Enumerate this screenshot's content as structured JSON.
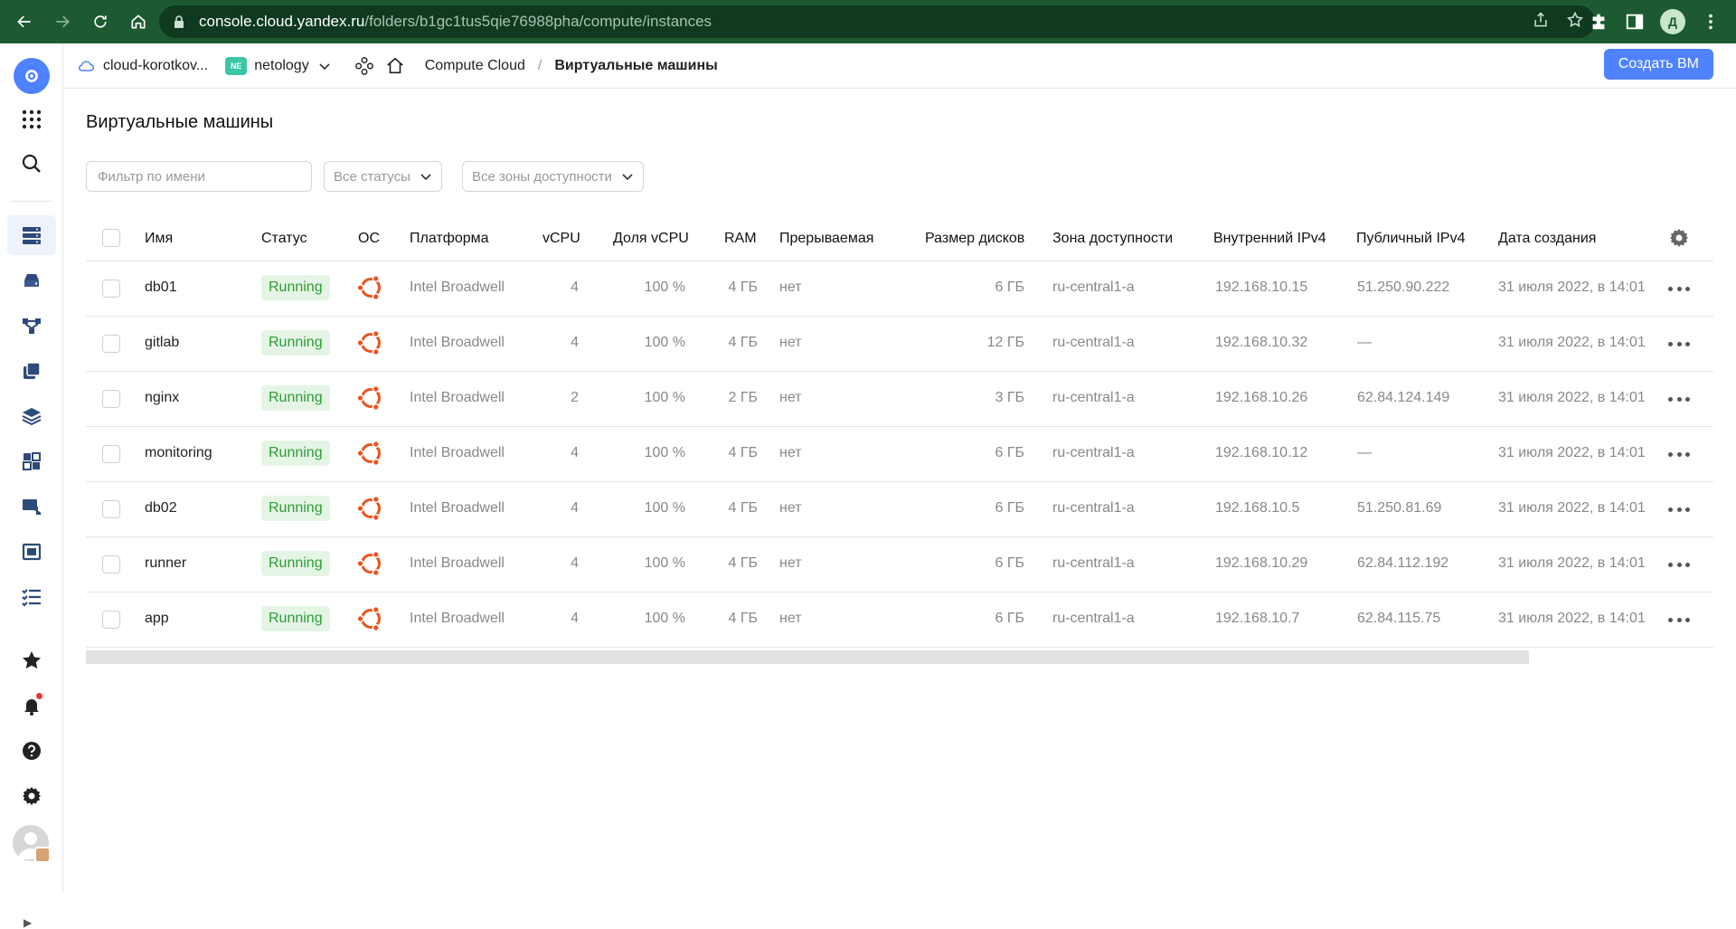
{
  "browser": {
    "url_host": "console.cloud.yandex.ru",
    "url_path": "/folders/b1gc1tus5qie76988pha/compute/instances",
    "profile_initial": "Д"
  },
  "header": {
    "cloud_name": "cloud-korotkov...",
    "folder_badge": "NE",
    "folder_name": "netology",
    "breadcrumb_service": "Compute Cloud",
    "breadcrumb_sep": "/",
    "breadcrumb_current": "Виртуальные машины",
    "create_button": "Создать ВМ"
  },
  "page": {
    "title": "Виртуальные машины",
    "filter_placeholder": "Фильтр по имени",
    "status_select": "Все статусы",
    "zone_select": "Все зоны доступности"
  },
  "table": {
    "columns": {
      "name": "Имя",
      "status": "Статус",
      "os": "ОС",
      "platform": "Платформа",
      "vcpu": "vCPU",
      "vcpu_share": "Доля vCPU",
      "ram": "RAM",
      "preemptible": "Прерываемая",
      "disk_size": "Размер дисков",
      "zone": "Зона доступности",
      "internal_ip": "Внутренний IPv4",
      "public_ip": "Публичный IPv4",
      "created": "Дата создания"
    },
    "rows": [
      {
        "name": "db01",
        "status": "Running",
        "platform": "Intel Broadwell",
        "vcpu": "4",
        "share": "100 %",
        "ram": "4 ГБ",
        "preemptible": "нет",
        "disk": "6 ГБ",
        "zone": "ru-central1-a",
        "internal_ip": "192.168.10.15",
        "public_ip": "51.250.90.222",
        "created": "31 июля 2022, в 14:01"
      },
      {
        "name": "gitlab",
        "status": "Running",
        "platform": "Intel Broadwell",
        "vcpu": "4",
        "share": "100 %",
        "ram": "4 ГБ",
        "preemptible": "нет",
        "disk": "12 ГБ",
        "zone": "ru-central1-a",
        "internal_ip": "192.168.10.32",
        "public_ip": "—",
        "created": "31 июля 2022, в 14:01"
      },
      {
        "name": "nginx",
        "status": "Running",
        "platform": "Intel Broadwell",
        "vcpu": "2",
        "share": "100 %",
        "ram": "2 ГБ",
        "preemptible": "нет",
        "disk": "3 ГБ",
        "zone": "ru-central1-a",
        "internal_ip": "192.168.10.26",
        "public_ip": "62.84.124.149",
        "created": "31 июля 2022, в 14:01"
      },
      {
        "name": "monitoring",
        "status": "Running",
        "platform": "Intel Broadwell",
        "vcpu": "4",
        "share": "100 %",
        "ram": "4 ГБ",
        "preemptible": "нет",
        "disk": "6 ГБ",
        "zone": "ru-central1-a",
        "internal_ip": "192.168.10.12",
        "public_ip": "—",
        "created": "31 июля 2022, в 14:01"
      },
      {
        "name": "db02",
        "status": "Running",
        "platform": "Intel Broadwell",
        "vcpu": "4",
        "share": "100 %",
        "ram": "4 ГБ",
        "preemptible": "нет",
        "disk": "6 ГБ",
        "zone": "ru-central1-a",
        "internal_ip": "192.168.10.5",
        "public_ip": "51.250.81.69",
        "created": "31 июля 2022, в 14:01"
      },
      {
        "name": "runner",
        "status": "Running",
        "platform": "Intel Broadwell",
        "vcpu": "4",
        "share": "100 %",
        "ram": "4 ГБ",
        "preemptible": "нет",
        "disk": "6 ГБ",
        "zone": "ru-central1-a",
        "internal_ip": "192.168.10.29",
        "public_ip": "62.84.112.192",
        "created": "31 июля 2022, в 14:01"
      },
      {
        "name": "app",
        "status": "Running",
        "platform": "Intel Broadwell",
        "vcpu": "4",
        "share": "100 %",
        "ram": "4 ГБ",
        "preemptible": "нет",
        "disk": "6 ГБ",
        "zone": "ru-central1-a",
        "internal_ip": "192.168.10.7",
        "public_ip": "62.84.115.75",
        "created": "31 июля 2022, в 14:01"
      }
    ]
  },
  "colors": {
    "accent": "#4e82ff",
    "running_bg": "#e5f5e5",
    "running_text": "#2a9d34",
    "ubuntu": "#e95420",
    "browser_bar": "#1d5a32"
  }
}
